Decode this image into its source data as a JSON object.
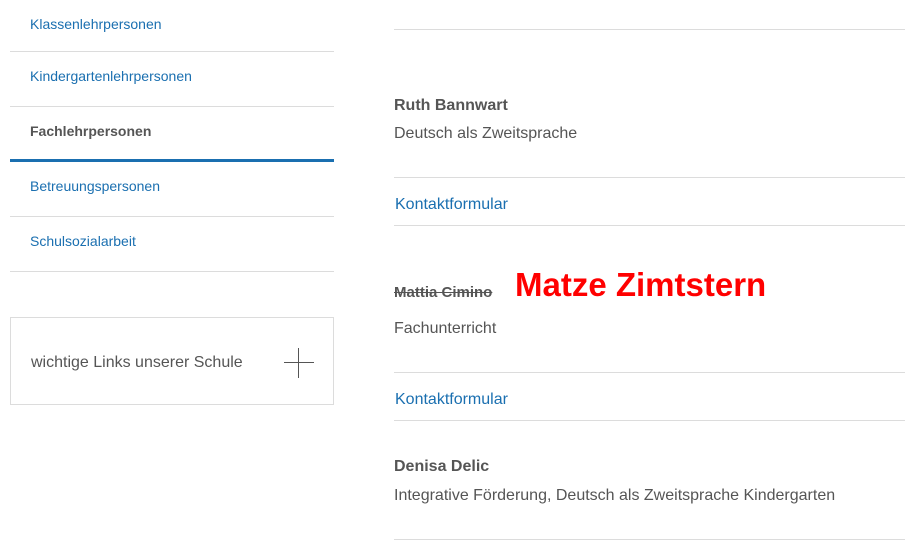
{
  "sidebar": {
    "items": [
      {
        "label": "Klassenlehrpersonen"
      },
      {
        "label": "Kindergartenlehrpersonen"
      },
      {
        "label": "Fachlehrpersonen"
      },
      {
        "label": "Betreuungspersonen"
      },
      {
        "label": "Schulsozialarbeit"
      }
    ],
    "links_box": {
      "label": "wichtige Links unserer Schule",
      "icon": "plus-icon"
    }
  },
  "people": [
    {
      "name": "Ruth Bannwart",
      "role": "Deutsch als Zweitsprache",
      "contact": "Kontaktformular"
    },
    {
      "name": "Mattia Cimino",
      "name_replacement": "Matze Zimtstern",
      "role": "Fachunterricht",
      "contact": "Kontaktformular"
    },
    {
      "name": "Denisa Delic",
      "role": "Integrative Förderung, Deutsch als Zweitsprache Kindergarten"
    }
  ],
  "colors": {
    "link": "#1a6fb0",
    "text": "#555555",
    "annotation": "#ff0000",
    "active_underline": "#1a6fb0"
  }
}
